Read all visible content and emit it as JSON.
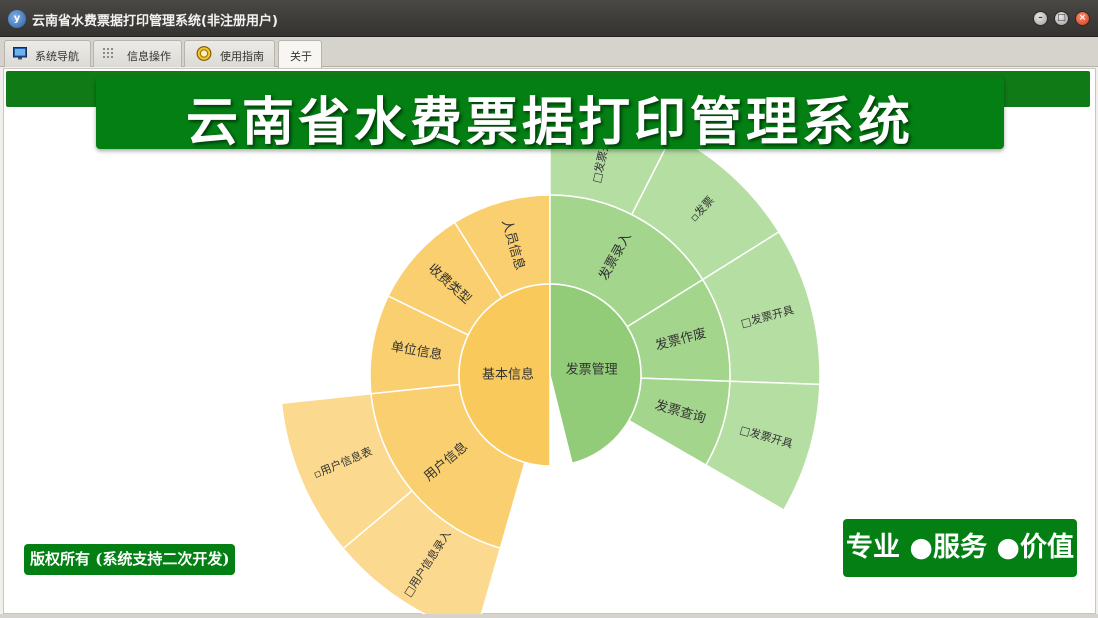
{
  "window": {
    "title": "云南省水费票据打印管理系统(非注册用户)",
    "logo_text": "y",
    "min_icon": "–",
    "max_icon": "□",
    "close_icon": "×"
  },
  "tabs": [
    {
      "label": "系统导航",
      "icon": "monitor-icon",
      "active": false
    },
    {
      "label": "信息操作",
      "icon": "grid-icon",
      "active": false
    },
    {
      "label": "使用指南",
      "icon": "compass-icon",
      "active": false
    },
    {
      "label": "关于",
      "icon": "",
      "active": true
    }
  ],
  "banner": {
    "title": "云南省水费票据打印管理系统"
  },
  "menu": {
    "root_items": [
      {
        "label": "基本信息",
        "color": "#f9c95c",
        "children": [
          {
            "label": "人员信息",
            "color": "#f9cf70",
            "children": []
          },
          {
            "label": "收费类型",
            "color": "#f9cf70",
            "children": []
          },
          {
            "label": "单位信息",
            "color": "#f9cf70",
            "children": []
          },
          {
            "label": "用户信息",
            "color": "#f9cf70",
            "children": [
              {
                "label": "▫用户信息表",
                "color": "#fbd98e"
              },
              {
                "label": "□用户信息录入",
                "color": "#fbd98e"
              }
            ]
          }
        ]
      },
      {
        "label": "发票管理",
        "color": "#92cc78",
        "children": [
          {
            "label": "发票录入",
            "color": "#a3d58c",
            "children": [
              {
                "label": "□发票开具",
                "color": "#b5dea3"
              },
              {
                "label": "▫发票",
                "color": "#b5dea3"
              }
            ]
          },
          {
            "label": "发票作废",
            "color": "#a3d58c",
            "children": [
              {
                "label": "□发票开具",
                "color": "#b5dea3"
              }
            ]
          },
          {
            "label": "发票查询",
            "color": "#a3d58c",
            "children": [
              {
                "label": "□发票开具",
                "color": "#b5dea3"
              }
            ]
          }
        ]
      }
    ]
  },
  "footer": {
    "copyright": "版权所有 (系统支持二次开发)",
    "slogan": "专业 ●服务 ●价值"
  },
  "colors": {
    "brand_green": "#037f13",
    "title_bar": "#3f3d39",
    "label_text": "#333333"
  }
}
